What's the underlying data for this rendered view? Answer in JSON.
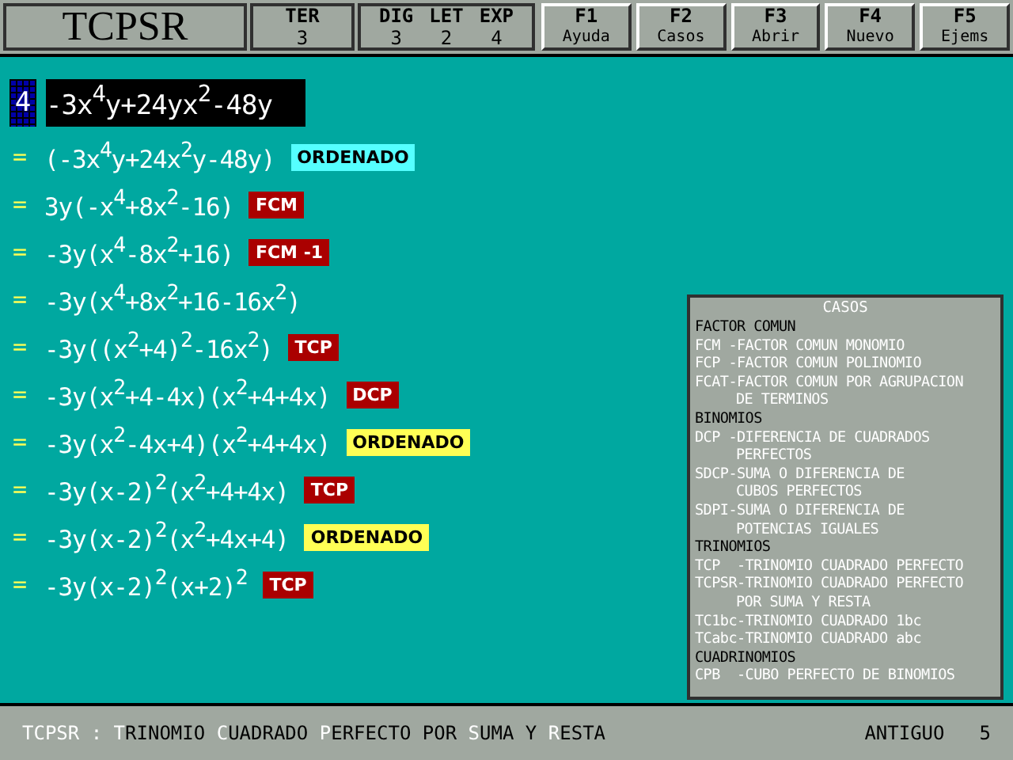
{
  "header": {
    "title": "TCPSR",
    "counters": [
      {
        "label": "TER",
        "value": "3"
      }
    ],
    "counters_group": [
      {
        "label": "DIG",
        "value": "3"
      },
      {
        "label": "LET",
        "value": "2"
      },
      {
        "label": "EXP",
        "value": "4"
      }
    ],
    "keys": [
      {
        "key": "F1",
        "label": "Ayuda"
      },
      {
        "key": "F2",
        "label": "Casos"
      },
      {
        "key": "F3",
        "label": "Abrir"
      },
      {
        "key": "F4",
        "label": "Nuevo"
      },
      {
        "key": "F5",
        "label": "Ejems"
      }
    ]
  },
  "input": {
    "index": "4",
    "expression": "-3x$^{4}$y+24yx$^{2}$-48y"
  },
  "steps": [
    {
      "sign": "=",
      "expression": "(-3x$^{4}$y+24x$^{2}$y-48y)",
      "tag": "ORDENADO",
      "color": "#55ffff"
    },
    {
      "sign": "=",
      "expression": "3y(-x$^{4}$+8x$^{2}$-16)",
      "tag": "FCM",
      "color": "#aa0000"
    },
    {
      "sign": "=",
      "expression": "-3y(x$^{4}$-8x$^{2}$+16)",
      "tag": "FCM -1",
      "color": "#aa0000"
    },
    {
      "sign": "=",
      "expression": "-3y(x$^{4}$+8x$^{2}$+16-16x$^{2}$)"
    },
    {
      "sign": "=",
      "expression": "-3y((x$^{2}$+4)$^{2}$-16x$^{2}$)",
      "tag": "TCP",
      "color": "#aa0000"
    },
    {
      "sign": "=",
      "expression": "-3y(x$^{2}$+4-4x)(x$^{2}$+4+4x)",
      "tag": "DCP",
      "color": "#aa0000"
    },
    {
      "sign": "=",
      "expression": "-3y(x$^{2}$-4x+4)(x$^{2}$+4+4x)",
      "tag": "ORDENADO",
      "color": "#ffff55"
    },
    {
      "sign": "=",
      "expression": "-3y(x-2)$^{2}$(x$^{2}$+4+4x)",
      "tag": "TCP",
      "color": "#aa0000"
    },
    {
      "sign": "=",
      "expression": "-3y(x-2)$^{2}$(x$^{2}$+4x+4)",
      "tag": "ORDENADO",
      "color": "#ffff55"
    },
    {
      "sign": "=",
      "expression": "-3y(x-2)$^{2}$(x+2)$^{2}$",
      "tag": "TCP",
      "color": "#aa0000"
    }
  ],
  "cases_panel": {
    "title": "CASOS",
    "lines": [
      {
        "kind": "heading",
        "text": "FACTOR COMUN"
      },
      {
        "kind": "entry",
        "text": "FCM -FACTOR COMUN MONOMIO"
      },
      {
        "kind": "entry",
        "text": "FCP -FACTOR COMUN POLINOMIO"
      },
      {
        "kind": "entry",
        "text": "FCAT-FACTOR COMUN POR AGRUPACION"
      },
      {
        "kind": "continuation",
        "text": "DE TERMINOS"
      },
      {
        "kind": "heading",
        "text": "BINOMIOS"
      },
      {
        "kind": "entry",
        "text": "DCP -DIFERENCIA DE CUADRADOS"
      },
      {
        "kind": "continuation",
        "text": "PERFECTOS"
      },
      {
        "kind": "entry",
        "text": "SDCP-SUMA O DIFERENCIA DE"
      },
      {
        "kind": "continuation",
        "text": "CUBOS PERFECTOS"
      },
      {
        "kind": "entry",
        "text": "SDPI-SUMA O DIFERENCIA DE"
      },
      {
        "kind": "continuation",
        "text": "POTENCIAS IGUALES"
      },
      {
        "kind": "heading",
        "text": "TRINOMIOS"
      },
      {
        "kind": "entry",
        "text": "TCP  -TRINOMIO CUADRADO PERFECTO"
      },
      {
        "kind": "entry",
        "text": "TCPSR-TRINOMIO CUADRADO PERFECTO"
      },
      {
        "kind": "continuation",
        "text": "POR SUMA Y RESTA"
      },
      {
        "kind": "entry",
        "text": "TC1bc-TRINOMIO CUADRADO 1bc"
      },
      {
        "kind": "entry",
        "text": "TCabc-TRINOMIO CUADRADO abc"
      },
      {
        "kind": "heading",
        "text": "CUADRINOMIOS"
      },
      {
        "kind": "entry",
        "text": "CPB  -CUBO PERFECTO DE BINOMIOS"
      }
    ]
  },
  "status_bar": {
    "segments": [
      {
        "text": "TCPSR : ",
        "highlight": true
      },
      {
        "text": "T",
        "highlight": true
      },
      {
        "text": "RINOMIO ",
        "highlight": false
      },
      {
        "text": "C",
        "highlight": true
      },
      {
        "text": "UADRADO ",
        "highlight": false
      },
      {
        "text": "P",
        "highlight": true
      },
      {
        "text": "ERFECTO POR ",
        "highlight": false
      },
      {
        "text": "S",
        "highlight": true
      },
      {
        "text": "UMA Y ",
        "highlight": false
      },
      {
        "text": "R",
        "highlight": true
      },
      {
        "text": "ESTA",
        "highlight": false
      }
    ],
    "mode": "ANTIGUO",
    "count": "5"
  }
}
